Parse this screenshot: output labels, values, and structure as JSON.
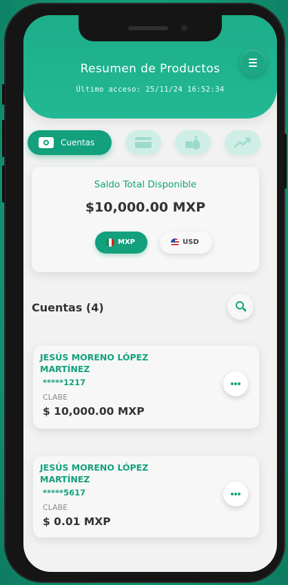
{
  "header": {
    "title": "Resumen de Productos",
    "last_access": "Último acceso: 25/11/24 16:52:34",
    "menu_icon": "hamburger-menu-icon"
  },
  "tabs": {
    "active": {
      "label": "Cuentas",
      "icon": "cash-icon"
    },
    "others": [
      {
        "icon": "credit-card-icon"
      },
      {
        "icon": "money-bag-icon"
      },
      {
        "icon": "trending-up-icon"
      }
    ]
  },
  "balance": {
    "title": "Saldo Total Disponible",
    "amount": "$10,000.00 MXP",
    "currencies": [
      {
        "label": "MXP",
        "flag": "mexico-flag-icon",
        "selected": true
      },
      {
        "label": "USD",
        "flag": "usa-flag-icon",
        "selected": false
      }
    ]
  },
  "accounts_section": {
    "title": "Cuentas (4)",
    "search_icon": "search-icon"
  },
  "accounts": [
    {
      "name": "JESÚS MORENO LÓPEZ MARTÍNEZ",
      "number": "*****1217",
      "clabe_label": "CLABE",
      "balance": "$ 10,000.00 MXP"
    },
    {
      "name": "JESÚS MORENO LÓPEZ MARTÍNEZ",
      "number": "*****5617",
      "clabe_label": "CLABE",
      "balance": "$ 0.01 MXP"
    }
  ],
  "colors": {
    "brand": "#13a07d",
    "header": "#21b892",
    "background": "#1fb58f",
    "screen": "#f1f2f1"
  }
}
